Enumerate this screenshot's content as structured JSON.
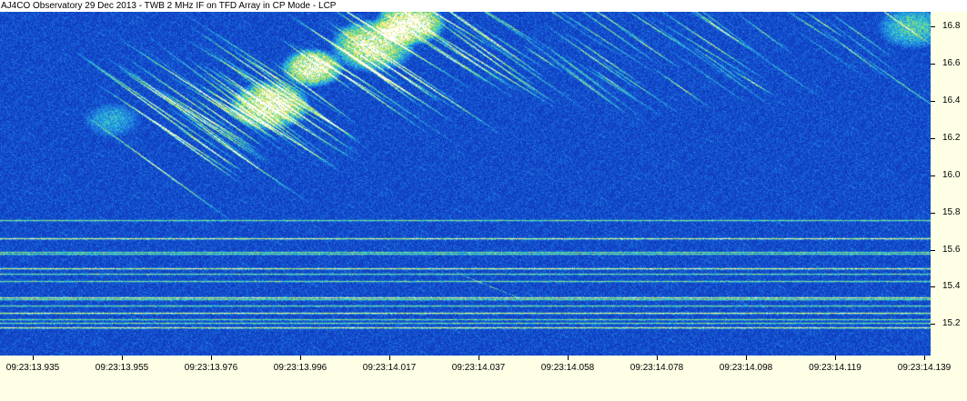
{
  "chart_data": {
    "type": "heatmap",
    "title": "AJ4CO Observatory 29 Dec 2013 - TWB 2 MHz IF on TFD Array in CP Mode - LCP",
    "xlabel": "",
    "ylabel": "",
    "x_tick_labels": [
      "09:23:13.935",
      "09:23:13.955",
      "09:23:13.976",
      "09:23:13.996",
      "09:23:14.017",
      "09:23:14.037",
      "09:23:14.058",
      "09:23:14.078",
      "09:23:14.098",
      "09:23:14.119",
      "09:23:14.139"
    ],
    "y_ticks": [
      15.2,
      15.4,
      15.6,
      15.8,
      16.0,
      16.2,
      16.4,
      16.6,
      16.8
    ],
    "y_tick_labels": [
      "15.2",
      "15.4",
      "15.6",
      "15.8",
      "16.0",
      "16.2",
      "16.4",
      "16.6",
      "16.8"
    ],
    "ylim": [
      15.03,
      16.88
    ],
    "y_axis_side": "right",
    "interference_lines_mhz": [
      15.18,
      15.205,
      15.225,
      15.26,
      15.3,
      15.335,
      15.345,
      15.43,
      15.47,
      15.5,
      15.58,
      15.59,
      15.66,
      15.76
    ],
    "emission_ridge": {
      "x": [
        0.16,
        0.25,
        0.33,
        0.4,
        0.46,
        0.52
      ],
      "y": [
        16.3,
        16.37,
        16.55,
        16.7,
        16.82,
        16.88
      ]
    },
    "colormap": [
      "#081a8c",
      "#1040c8",
      "#1e7fe0",
      "#30c8d8",
      "#7ee07a",
      "#f0e040",
      "#ffffff"
    ]
  }
}
